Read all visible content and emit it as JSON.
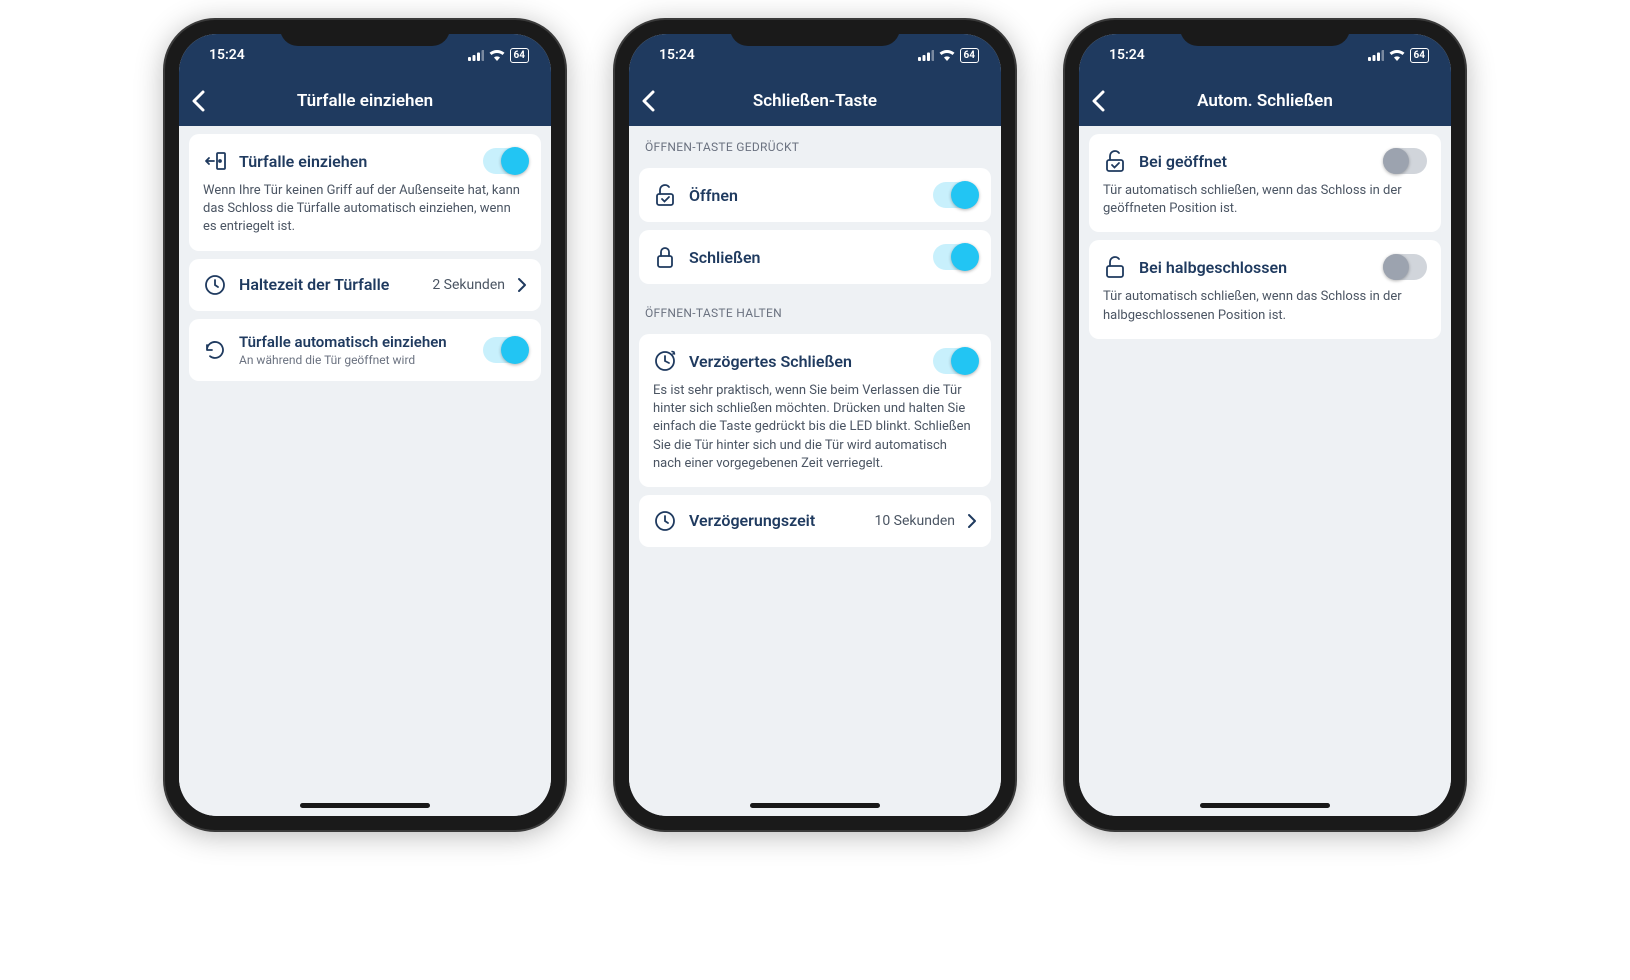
{
  "status": {
    "time": "15:24",
    "battery": "64"
  },
  "phone1": {
    "title": "Türfalle einziehen",
    "row1": {
      "label": "Türfalle einziehen",
      "desc": "Wenn Ihre Tür keinen Griff auf der Außenseite hat, kann das Schloss die Türfalle automatisch einziehen, wenn es entriegelt ist."
    },
    "row2": {
      "label": "Haltezeit der Türfalle",
      "value": "2 Sekunden"
    },
    "row3": {
      "label": "Türfalle automatisch einziehen",
      "sub": "An während die Tür geöffnet wird"
    }
  },
  "phone2": {
    "title": "Schließen-Taste",
    "section1": "ÖFFNEN-TASTE GEDRÜCKT",
    "row1": {
      "label": "Öffnen"
    },
    "row2": {
      "label": "Schließen"
    },
    "section2": "ÖFFNEN-TASTE HALTEN",
    "row3": {
      "label": "Verzögertes Schließen",
      "desc": "Es ist sehr praktisch, wenn Sie beim Verlassen die Tür hinter sich schließen möchten. Drücken und halten Sie einfach die Taste gedrückt bis die LED blinkt. Schließen Sie die Tür hinter sich und die Tür wird automatisch nach einer vorgegebenen Zeit verriegelt."
    },
    "row4": {
      "label": "Verzögerungszeit",
      "value": "10 Sekunden"
    }
  },
  "phone3": {
    "title": "Autom. Schließen",
    "row1": {
      "label": "Bei geöffnet",
      "desc": "Tür automatisch schließen, wenn das Schloss in der geöffneten Position ist."
    },
    "row2": {
      "label": "Bei halbgeschlossen",
      "desc": "Tür automatisch schließen, wenn das Schloss in der halbgeschlossenen Position ist."
    }
  }
}
